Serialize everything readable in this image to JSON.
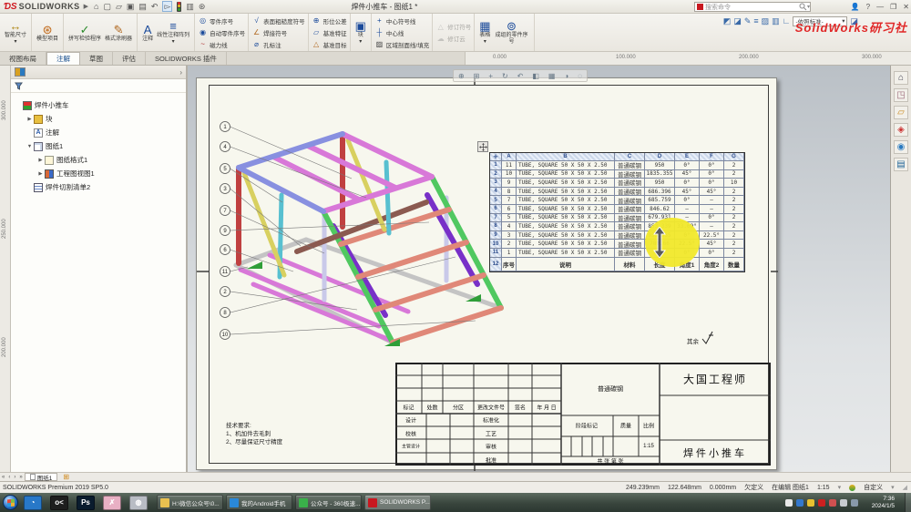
{
  "window": {
    "brand": "SOLIDWORKS",
    "title": "焊件小推车 - 图纸1 *",
    "search_placeholder": "搜索命令",
    "watermark": "SolidWorks研习社",
    "help": "?"
  },
  "quick_access": {
    "items": [
      {
        "name": "home-icon",
        "glyph": "⌂"
      },
      {
        "name": "new-file-icon",
        "glyph": "▢"
      },
      {
        "name": "open-file-icon",
        "glyph": "▱"
      },
      {
        "name": "save-icon",
        "glyph": "▣"
      },
      {
        "name": "print-icon",
        "glyph": "▤"
      },
      {
        "name": "undo-icon",
        "glyph": "↶"
      },
      {
        "name": "select-cursor-icon",
        "glyph": "▻",
        "pressed": true
      },
      {
        "name": "visibility-traffic-icon",
        "glyph": ""
      },
      {
        "name": "options-icon",
        "glyph": "▥"
      },
      {
        "name": "settings-icon",
        "glyph": "⊛"
      }
    ]
  },
  "ribbon": {
    "groups": [
      {
        "items": [
          {
            "name": "smart-dimension",
            "label": "智能尺寸",
            "glyph": "↔",
            "color": "#b08818",
            "big": true,
            "arrow": true
          }
        ]
      },
      {
        "items": [
          {
            "name": "model-items",
            "label": "模型项目",
            "glyph": "⊛",
            "color": "#c06818",
            "big": true
          }
        ]
      },
      {
        "items": [
          {
            "name": "spell-checker",
            "label": "拼写检验程序",
            "glyph": "✓",
            "color": "#2a8a2a",
            "big": true
          },
          {
            "name": "format-painter",
            "label": "格式涂刷器",
            "glyph": "✎",
            "color": "#b06820",
            "big": true
          }
        ]
      },
      {
        "items": [
          {
            "name": "note",
            "label": "注释",
            "glyph": "A",
            "color": "#1a4a9a",
            "big": true
          },
          {
            "name": "linear-note-pattern",
            "label": "线性注释阵列",
            "glyph": "≡",
            "color": "#1a4a9a",
            "big": true,
            "arrow": true
          }
        ]
      },
      {
        "stack": true,
        "items": [
          {
            "name": "balloon",
            "label": "零件序号",
            "glyph": "◎",
            "color": "#1a4a9a"
          },
          {
            "name": "auto-balloon",
            "label": "自动零件序号",
            "glyph": "◉",
            "color": "#1a4a9a"
          },
          {
            "name": "magnetic-line",
            "label": "磁力线",
            "glyph": "~",
            "color": "#b03030"
          }
        ]
      },
      {
        "stack": true,
        "items": [
          {
            "name": "surface-finish-symbol",
            "label": "表面粗糙度符号",
            "glyph": "√",
            "color": "#1a4a9a"
          },
          {
            "name": "weld-symbol",
            "label": "焊接符号",
            "glyph": "∠",
            "color": "#b06820"
          },
          {
            "name": "hole-callout",
            "label": "孔标注",
            "glyph": "⌀",
            "color": "#1a4a9a"
          }
        ]
      },
      {
        "stack": true,
        "items": [
          {
            "name": "geometric-tolerance",
            "label": "形位公差",
            "glyph": "⊕",
            "color": "#1a4a9a"
          },
          {
            "name": "datum-feature",
            "label": "基准特征",
            "glyph": "▱",
            "color": "#1a4a9a"
          },
          {
            "name": "datum-target",
            "label": "基准目标",
            "glyph": "△",
            "color": "#b06820"
          }
        ]
      },
      {
        "items": [
          {
            "name": "block",
            "label": "块",
            "glyph": "▣",
            "color": "#1a4a9a",
            "big": true,
            "arrow": true
          }
        ]
      },
      {
        "stack": true,
        "items": [
          {
            "name": "center-mark",
            "label": "中心符号线",
            "glyph": "+",
            "color": "#1a4a9a"
          },
          {
            "name": "centerline",
            "label": "中心线",
            "glyph": "┼",
            "color": "#1a4a9a"
          },
          {
            "name": "area-hatch-fill",
            "label": "区域剖面线/填充",
            "glyph": "▨",
            "color": "#444"
          }
        ]
      },
      {
        "stack": true,
        "items": [
          {
            "name": "revision-symbol",
            "label": "修订符号",
            "glyph": "△",
            "color": "#888",
            "disabled": true
          },
          {
            "name": "revision-cloud",
            "label": "修订云",
            "glyph": "☁",
            "color": "#888",
            "disabled": true
          }
        ]
      },
      {
        "items": [
          {
            "name": "table",
            "label": "表格",
            "glyph": "▦",
            "color": "#1a4a9a",
            "big": true,
            "arrow": true
          },
          {
            "name": "stacked-balloon",
            "label": "成组的零件序号",
            "glyph": "⊚",
            "color": "#1a4a9a",
            "big": true
          }
        ]
      }
    ]
  },
  "toolbar_right": {
    "icons": [
      {
        "name": "format-painter-icon",
        "glyph": "◩"
      },
      {
        "name": "eraser-icon",
        "glyph": "◪"
      },
      {
        "name": "pencil-icon",
        "glyph": "✎"
      },
      {
        "name": "line-format-icon",
        "glyph": "≡"
      },
      {
        "name": "hatch-icon",
        "glyph": "▨"
      },
      {
        "name": "layer-icon",
        "glyph": "▥"
      },
      {
        "name": "corner-icon",
        "glyph": "∟"
      }
    ],
    "standard_dropdown": "-依照标准-"
  },
  "command_tabs": [
    {
      "label": "视图布局"
    },
    {
      "label": "注解",
      "active": true
    },
    {
      "label": "草图"
    },
    {
      "label": "评估"
    },
    {
      "label": "SOLIDWORKS 插件"
    }
  ],
  "rulers": {
    "h": [
      "0.000",
      "100.000",
      "200.000",
      "300.000"
    ],
    "v": [
      "300.000",
      "250.000",
      "200.000"
    ]
  },
  "feature_tree": {
    "items": [
      {
        "label": "焊件小推车",
        "level": 0,
        "expander": "",
        "icon": "part-root-icon"
      },
      {
        "label": "块",
        "level": 1,
        "expander": "▶",
        "icon": "blocks-folder-icon"
      },
      {
        "label": "注解",
        "level": 1,
        "expander": "",
        "icon": "annotations-icon"
      },
      {
        "label": "图纸1",
        "level": 1,
        "expander": "▼",
        "icon": "sheet-icon"
      },
      {
        "label": "图纸格式1",
        "level": 2,
        "expander": "▶",
        "icon": "sheet-format-icon"
      },
      {
        "label": "工程图视图1",
        "level": 2,
        "expander": "▶",
        "icon": "drawing-view-icon"
      },
      {
        "label": "焊件切割清单2",
        "level": 1,
        "expander": "",
        "icon": "cut-list-icon"
      }
    ]
  },
  "hud_icons": [
    {
      "name": "zoom-fit-icon",
      "glyph": "⊕"
    },
    {
      "name": "zoom-area-icon",
      "glyph": "⊞"
    },
    {
      "name": "pan-icon",
      "glyph": "+"
    },
    {
      "name": "rotate-icon",
      "glyph": "↻"
    },
    {
      "name": "previous-view-icon",
      "glyph": "↶"
    },
    {
      "name": "section-view-icon",
      "glyph": "◧"
    },
    {
      "name": "view-orientation-icon",
      "glyph": "▦"
    },
    {
      "name": "display-style-icon",
      "glyph": "◑"
    },
    {
      "name": "hide-show-icon",
      "glyph": "◌"
    }
  ],
  "taskpane_icons": [
    {
      "name": "resources-icon",
      "glyph": "⌂",
      "color": "#445"
    },
    {
      "name": "design-library-icon",
      "glyph": "◳",
      "color": "#967"
    },
    {
      "name": "file-explorer-icon",
      "glyph": "▱",
      "color": "#ca8a20"
    },
    {
      "name": "view-palette-icon",
      "glyph": "◈",
      "color": "#c33"
    },
    {
      "name": "appearances-icon",
      "glyph": "◉",
      "color": "#2a7ac0"
    },
    {
      "name": "custom-properties-icon",
      "glyph": "▤",
      "color": "#269"
    }
  ],
  "cut_list": {
    "col_letters": [
      "A",
      "B",
      "C",
      "D",
      "E",
      "F",
      "G"
    ],
    "rows": [
      [
        "11",
        "TUBE, SQUARE 50 X 50 X 2.50",
        "普通碳钢",
        "950",
        "0°",
        "0°",
        "2"
      ],
      [
        "10",
        "TUBE, SQUARE 50 X 50 X 2.50",
        "普通碳钢",
        "1835.355",
        "45°",
        "0°",
        "2"
      ],
      [
        "9",
        "TUBE, SQUARE 50 X 50 X 2.50",
        "普通碳钢",
        "950",
        "0°",
        "0°",
        "10"
      ],
      [
        "8",
        "TUBE, SQUARE 50 X 50 X 2.50",
        "普通碳钢",
        "686.396",
        "45°",
        "45°",
        "2"
      ],
      [
        "7",
        "TUBE, SQUARE 50 X 50 X 2.50",
        "普通碳钢",
        "685.759",
        "0°",
        "–",
        "2"
      ],
      [
        "6",
        "TUBE, SQUARE 50 X 50 X 2.50",
        "普通碳钢",
        "846.62",
        "–",
        "–",
        "2"
      ],
      [
        "5",
        "TUBE, SQUARE 50 X 50 X 2.50",
        "普通碳钢",
        "679.931",
        "–",
        "0°",
        "2"
      ],
      [
        "4",
        "TUBE, SQUARE 50 X 50 X 2.50",
        "普通碳钢",
        "853.339",
        "33.69°",
        "–",
        "2"
      ],
      [
        "3",
        "TUBE, SQUARE 50 X 50 X 2.50",
        "普通碳钢",
        "935.355",
        "0°",
        "22.5°",
        "2"
      ],
      [
        "2",
        "TUBE, SQUARE 50 X 50 X 2.50",
        "普通碳钢",
        "780.66",
        "22.5°",
        "45°",
        "2"
      ],
      [
        "1",
        "TUBE, SQUARE 50 X 50 X 2.50",
        "普通碳钢",
        "700",
        "0°",
        "0°",
        "2"
      ]
    ],
    "footer": [
      "序号",
      "说明",
      "材料",
      "长度",
      "角度1",
      "角度2",
      "数量"
    ]
  },
  "drawing": {
    "balloons": [
      "1",
      "4",
      "5",
      "3",
      "7",
      "9",
      "6",
      "11",
      "2",
      "8",
      "10"
    ],
    "notes": {
      "title": "技术要求:",
      "lines": [
        "1、机加件去毛刺",
        "2、尽量保证尺寸精度"
      ]
    },
    "surface_finish_label": "其余",
    "palette": {
      "pink": "#d878d8",
      "blue": "#8890e0",
      "red": "#c04040",
      "yellow": "#d8d060",
      "cyan": "#58c0d0",
      "brown": "#8b5a50",
      "green": "#50c860",
      "salmon": "#e08878",
      "purple": "#7830c8",
      "gray": "#c4c4c4",
      "lavender": "#c9c9e9",
      "wedge": "#2f9e38"
    }
  },
  "title_block": {
    "rev_headers": [
      "标记",
      "处数",
      "分区",
      "更改文件号",
      "签名",
      "年 月 日"
    ],
    "sig_left": [
      "设计",
      "校核",
      "主管设计"
    ],
    "sig_mid": [
      "标准化",
      "工艺",
      "审核",
      "批准"
    ],
    "material": "普通碳钢",
    "company": "大国工程师",
    "stage_label": "阶段标记",
    "mass_label": "质量",
    "scale_label": "比例",
    "scale_value": "1:15",
    "sheets_row": "共    张    第    张",
    "part_name": "焊件小推车"
  },
  "sheet_tab": {
    "label": "图纸1"
  },
  "status": {
    "app": "SOLIDWORKS Premium 2019 SP5.0",
    "x": "249.239mm",
    "y": "122.648mm",
    "z": "0.000mm",
    "constraint": "欠定义",
    "editing": "在编辑 图纸1",
    "scale": "1:15",
    "custom": "自定义"
  },
  "taskbar": {
    "pinned": [
      {
        "name": "app-blue-icon",
        "bg": "#2878c8",
        "glyph": "◔"
      },
      {
        "name": "code-app-icon",
        "bg": "#1e1e1e",
        "glyph": "o<"
      },
      {
        "name": "photoshop-icon",
        "bg": "#0a1c2e",
        "glyph": "Ps"
      },
      {
        "name": "photo-app-icon",
        "bg": "#e8b0c4",
        "glyph": "✗"
      },
      {
        "name": "utility-app-icon",
        "bg": "#b8bcc4",
        "glyph": "◍"
      }
    ],
    "buttons": [
      {
        "name": "folder-window",
        "label": "H:\\微信公众号\\0...",
        "icon": "#e8c050"
      },
      {
        "name": "android-window",
        "label": "我的Android手机",
        "icon": "#2a88d8"
      },
      {
        "name": "browser-window",
        "label": "公众号 - 360极速...",
        "icon": "#3ab04a"
      },
      {
        "name": "solidworks-window",
        "label": "SOLIDWORKS P...",
        "icon": "#c81820",
        "active": true
      }
    ],
    "clock": {
      "time": "7:36",
      "date": "2024/1/5"
    }
  }
}
